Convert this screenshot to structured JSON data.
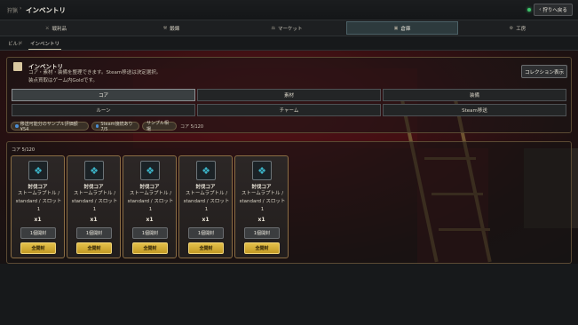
{
  "header": {
    "breadcrumb_root": "狩猟",
    "breadcrumb_sep": "›",
    "title": "インベントリ",
    "back_button": "狩りへ戻る"
  },
  "nav": {
    "tabs": [
      {
        "label": "戦利品",
        "icon": "sword-icon",
        "active": false
      },
      {
        "label": "鍛錬",
        "icon": "anvil-icon",
        "active": false
      },
      {
        "label": "マーケット",
        "icon": "market-icon",
        "active": false
      },
      {
        "label": "倉庫",
        "icon": "box-icon",
        "active": true
      },
      {
        "label": "工房",
        "icon": "gear-icon",
        "active": false
      }
    ]
  },
  "subtabs": {
    "items": [
      "ビルド",
      "インベントリ"
    ],
    "active": "インベントリ"
  },
  "inventory": {
    "title": "インベントリ",
    "description_line1": "コア・素材・装備を整理できます。Steam移送は決定選択。",
    "description_line2": "装点買取はゲーム内Goldです。",
    "collection_button": "コレクション表示",
    "filters_row1": [
      "コア",
      "素材",
      "装備"
    ],
    "filters_row2": [
      "ルーン",
      "チャーム",
      "Steam移送"
    ],
    "active_filter": "コア",
    "chips": [
      {
        "label": "移送可能分のサンプル評価額 ¥54"
      },
      {
        "label": "Steam接続あり 7/5"
      },
      {
        "label": "サンプル相場"
      }
    ],
    "core_count_label": "コア 5/120"
  },
  "core_section": {
    "label": "コア 5/120",
    "cards": [
      {
        "name": "討伐コア",
        "desc1": "ストームラプトル /",
        "desc2": "standard / スロット",
        "desc3": "1",
        "qty": "x1",
        "open_one": "1個開封",
        "open_all": "全開封"
      },
      {
        "name": "討伐コア",
        "desc1": "ストームラプトル /",
        "desc2": "standard / スロット",
        "desc3": "1",
        "qty": "x1",
        "open_one": "1個開封",
        "open_all": "全開封"
      },
      {
        "name": "討伐コア",
        "desc1": "ストームラプトル /",
        "desc2": "standard / スロット",
        "desc3": "1",
        "qty": "x1",
        "open_one": "1個開封",
        "open_all": "全開封"
      },
      {
        "name": "討伐コア",
        "desc1": "ストームラプトル /",
        "desc2": "standard / スロット",
        "desc3": "1",
        "qty": "x1",
        "open_one": "1個開封",
        "open_all": "全開封"
      },
      {
        "name": "討伐コア",
        "desc1": "ストームラプトル /",
        "desc2": "standard / スロット",
        "desc3": "1",
        "qty": "x1",
        "open_one": "1個開封",
        "open_all": "全開封"
      }
    ]
  },
  "colors": {
    "accent_gold": "#c29a24",
    "status_online": "#3ec46b",
    "card_border": "#8a6d44"
  }
}
